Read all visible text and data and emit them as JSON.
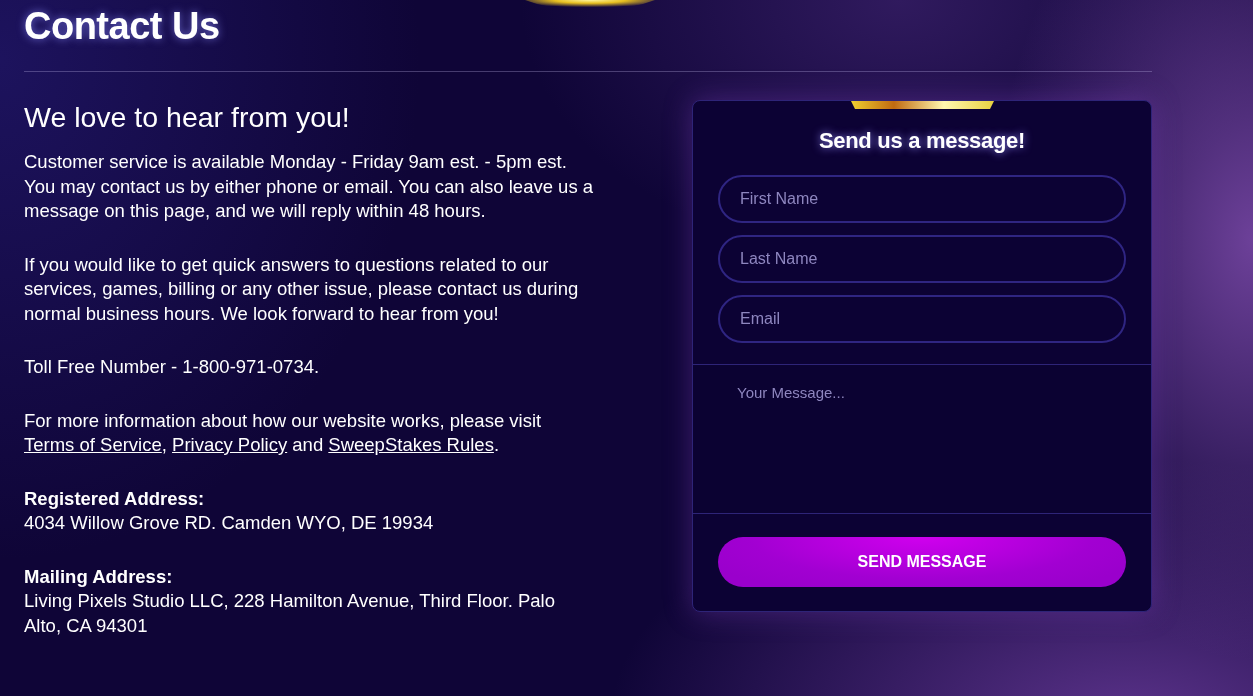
{
  "page": {
    "title": "Contact Us"
  },
  "intro": {
    "heading": "We love to hear from you!",
    "paragraphs": [
      "Customer service is available Monday - Friday 9am est. - 5pm est. You may contact us by either phone or email. You can also leave us a message on this page, and we will reply within 48 hours.",
      "If you would like to get quick answers to questions related to our services, games, billing or any other issue, please contact us during normal business hours. We look forward to hear from you!",
      "Toll Free Number - 1-800-971-0734."
    ],
    "policy_note": [
      {
        "kind": "text",
        "text": "For more information about how our website works, please visit "
      },
      {
        "kind": "link",
        "text": "Terms of Service"
      },
      {
        "kind": "text",
        "text": ", "
      },
      {
        "kind": "link",
        "text": "Privacy Policy"
      },
      {
        "kind": "text",
        "text": " and "
      },
      {
        "kind": "link",
        "text": "SweepStakes Rules"
      },
      {
        "kind": "text",
        "text": "."
      }
    ],
    "addresses": [
      {
        "label": "Registered Address:",
        "value": "4034 Willow Grove RD. Camden WYO, DE 19934"
      },
      {
        "label": "Mailing Address:",
        "value": "Living Pixels Studio LLC, 228 Hamilton Avenue, Third Floor. Palo Alto, CA 94301"
      }
    ]
  },
  "form": {
    "title": "Send us a message!",
    "fields": [
      {
        "placeholder": "First Name"
      },
      {
        "placeholder": "Last Name"
      },
      {
        "placeholder": "Email"
      }
    ],
    "message": {
      "placeholder": "Your Message..."
    },
    "submit": "SEND MESSAGE"
  }
}
